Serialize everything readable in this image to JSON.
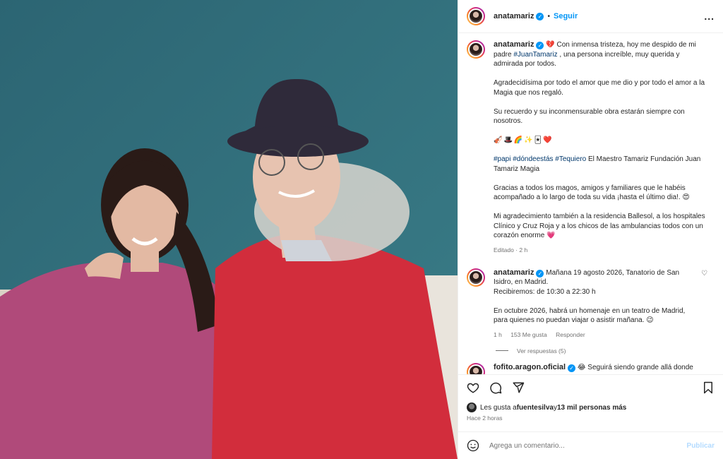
{
  "header": {
    "username": "anatamariz",
    "separator": "•",
    "follow_label": "Seguir",
    "more_label": "..."
  },
  "caption": {
    "username": "anatamariz",
    "line1_pre": "💔 Con inmensa tristeza, hoy me despido de mi padre ",
    "line1_tag": "#JuanTamariz",
    "line1_post": " , una persona increíble, muy querida y admirada por todos.",
    "p2": "Agradecidísima por todo el amor que me dio y por todo el amor a la Magia que nos regaló.",
    "p3": "Su recuerdo y su inconmensurable obra estarán siempre con nosotros.",
    "emojis": "🎻🎩🌈✨🃏❤️",
    "tags": "#papi #dóndeestás #Tequiero",
    "tags_post": " El Maestro Tamariz Fundación Juan Tamariz Magia",
    "p5": "Gracias a todos los magos, amigos y familiares que le habéis acompañado a lo largo de toda su vida ¡hasta el último dia!. 😍",
    "p6": "Mi agradecimiento también a la residencia Ballesol, a los hospitales Clínico y Cruz Roja y a los chicos de las ambulancias todos con un corazón enorme 💗",
    "edited": "Editado · 2 h"
  },
  "comment1": {
    "username": "anatamariz",
    "text1": "Mañana 19 agosto 2026, Tanatorio de San Isidro, en Madrid.",
    "text2": "Recibiremos: de 10:30 a 22:30 h",
    "text3": "En octubre 2026, habrá un homenaje en un teatro de Madrid, para quienes no puedan viajar o asistir mañana. 😉",
    "time": "1 h",
    "likes": "153 Me gusta",
    "reply": "Responder",
    "view_replies": "Ver respuestas (5)"
  },
  "comment2": {
    "username": "fofito.aragon.oficial",
    "text": "😂 Seguirá siendo grande allá donde"
  },
  "likes_bar": {
    "prefix": "Les gusta a ",
    "user": "fuentesilva",
    "middle": " y ",
    "others": "13 mil personas más"
  },
  "posted": "Hace 2 horas",
  "composer": {
    "placeholder": "Agrega un comentario...",
    "publish": "Publicar"
  },
  "colors": {
    "accent": "#0095f6",
    "publish_disabled": "#b3dbff",
    "background_wall": "#2f6b78"
  }
}
